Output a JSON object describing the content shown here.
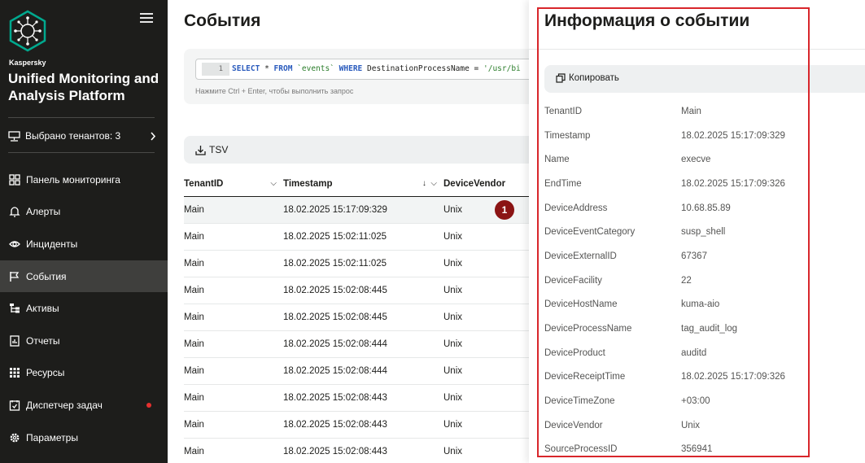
{
  "sidebar": {
    "brand_small": "Kaspersky",
    "brand_title": "Unified Monitoring and Analysis Platform",
    "tenants_label": "Выбрано тенантов: 3",
    "items": [
      {
        "label": "Панель мониторинга",
        "icon": "dashboard-icon"
      },
      {
        "label": "Алерты",
        "icon": "bell-icon"
      },
      {
        "label": "Инциденты",
        "icon": "eye-icon"
      },
      {
        "label": "События",
        "icon": "flag-icon"
      },
      {
        "label": "Активы",
        "icon": "tree-icon"
      },
      {
        "label": "Отчеты",
        "icon": "report-icon"
      },
      {
        "label": "Ресурсы",
        "icon": "grid-icon"
      },
      {
        "label": "Диспетчер задач",
        "icon": "task-icon"
      },
      {
        "label": "Параметры",
        "icon": "gear-icon"
      }
    ],
    "active_item": "События"
  },
  "main": {
    "title": "События",
    "query": {
      "line_number": "1",
      "kw_select": "SELECT",
      "star": "*",
      "kw_from": "FROM",
      "table": "`events`",
      "kw_where": "WHERE",
      "condition": "DestinationProcessName =",
      "value": "'/usr/bi"
    },
    "query_hint": "Нажмите Ctrl + Enter, чтобы выполнить запрос",
    "tsv_label": "TSV",
    "columns": [
      "TenantID",
      "Timestamp",
      "DeviceVendor"
    ],
    "rows": [
      [
        "Main",
        "18.02.2025 15:17:09:329",
        "Unix"
      ],
      [
        "Main",
        "18.02.2025 15:02:11:025",
        "Unix"
      ],
      [
        "Main",
        "18.02.2025 15:02:11:025",
        "Unix"
      ],
      [
        "Main",
        "18.02.2025 15:02:08:445",
        "Unix"
      ],
      [
        "Main",
        "18.02.2025 15:02:08:445",
        "Unix"
      ],
      [
        "Main",
        "18.02.2025 15:02:08:444",
        "Unix"
      ],
      [
        "Main",
        "18.02.2025 15:02:08:444",
        "Unix"
      ],
      [
        "Main",
        "18.02.2025 15:02:08:443",
        "Unix"
      ],
      [
        "Main",
        "18.02.2025 15:02:08:443",
        "Unix"
      ],
      [
        "Main",
        "18.02.2025 15:02:08:443",
        "Unix"
      ]
    ],
    "callout": "1"
  },
  "panel": {
    "title": "Информация о событии",
    "copy_label": "Копировать",
    "fields": [
      [
        "TenantID",
        "Main"
      ],
      [
        "Timestamp",
        "18.02.2025 15:17:09:329"
      ],
      [
        "Name",
        "execve"
      ],
      [
        "EndTime",
        "18.02.2025 15:17:09:326"
      ],
      [
        "DeviceAddress",
        "10.68.85.89"
      ],
      [
        "DeviceEventCategory",
        "susp_shell"
      ],
      [
        "DeviceExternalID",
        "67367"
      ],
      [
        "DeviceFacility",
        "22"
      ],
      [
        "DeviceHostName",
        "kuma-aio"
      ],
      [
        "DeviceProcessName",
        "tag_audit_log"
      ],
      [
        "DeviceProduct",
        "auditd"
      ],
      [
        "DeviceReceiptTime",
        "18.02.2025 15:17:09:326"
      ],
      [
        "DeviceTimeZone",
        "+03:00"
      ],
      [
        "DeviceVendor",
        "Unix"
      ],
      [
        "SourceProcessID",
        "356941"
      ]
    ]
  },
  "colors": {
    "sidebar_bg": "#1d1d1b",
    "sidebar_active": "#3f3f3d",
    "logo_accent": "#00a88e",
    "callout": "#8b1414",
    "highlight": "#d8262b",
    "notification_dot": "#e5302f"
  }
}
